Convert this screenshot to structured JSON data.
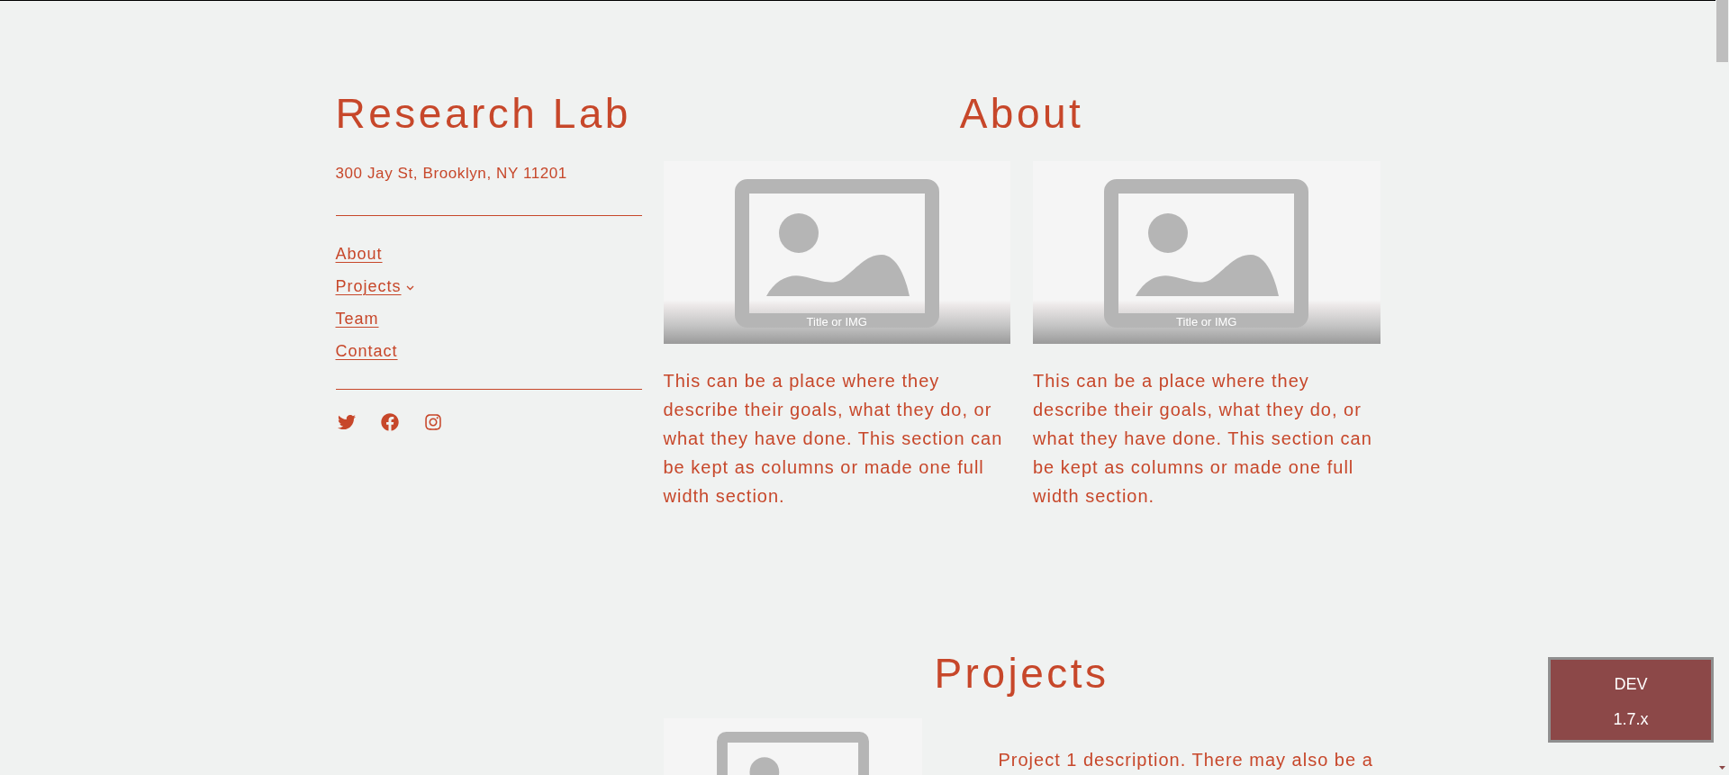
{
  "site": {
    "title": "Research Lab",
    "address": "300 Jay St, Brooklyn, NY 11201"
  },
  "nav": [
    {
      "label": "About",
      "has_submenu": false
    },
    {
      "label": "Projects",
      "has_submenu": true
    },
    {
      "label": "Team",
      "has_submenu": false
    },
    {
      "label": "Contact",
      "has_submenu": false
    }
  ],
  "about": {
    "heading": "About",
    "columns": [
      {
        "image_caption": "Title or IMG",
        "text": "This can be a place where they describe their goals, what they do, or what they have done. This section can be kept as columns or made one full width section."
      },
      {
        "image_caption": "Title or IMG",
        "text": "This can be a place where they describe their goals, what they do, or what they have done. This section can be kept as columns or made one full width section."
      }
    ]
  },
  "projects": {
    "heading": "Projects",
    "items": [
      {
        "text": "Project 1 description. There may also be a"
      }
    ]
  },
  "dev_badge": {
    "environment": "DEV",
    "version": "1.7.x"
  }
}
